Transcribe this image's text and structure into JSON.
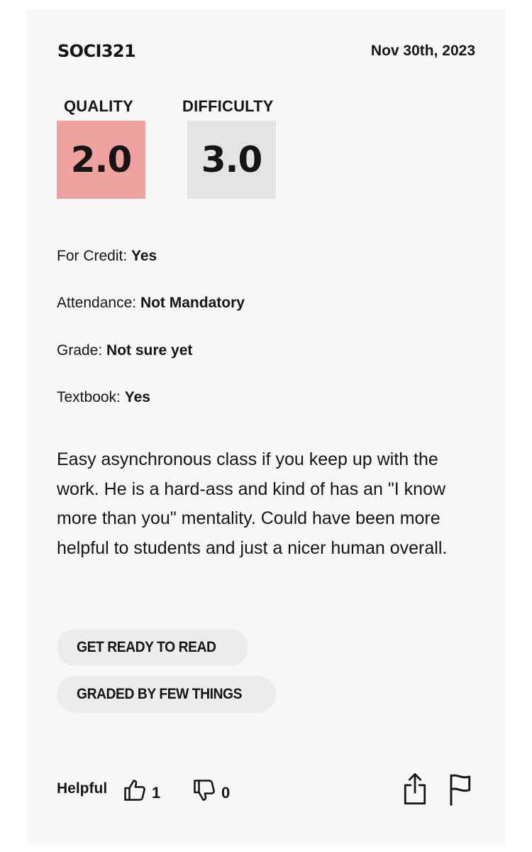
{
  "rating": {
    "course": "SOCI321",
    "date": "Nov 30th, 2023",
    "quality": {
      "label": "QUALITY",
      "value": "2.0",
      "color": "#f0a29f"
    },
    "difficulty": {
      "label": "DIFFICULTY",
      "value": "3.0",
      "color": "#e4e4e4"
    },
    "meta": [
      {
        "label": "For Credit:",
        "value": "Yes"
      },
      {
        "label": "Attendance:",
        "value": "Not Mandatory"
      },
      {
        "label": "Grade:",
        "value": "Not sure yet"
      },
      {
        "label": "Textbook:",
        "value": "Yes"
      }
    ],
    "comment": "Easy asynchronous class if you keep up with the work. He is a hard-ass and kind of has an \"I know more than you\" mentality. Could have been more helpful to students and just a nicer human overall.",
    "tags": [
      "GET READY TO READ",
      "GRADED BY FEW THINGS"
    ],
    "footer": {
      "helpful_label": "Helpful",
      "thumbs_up_count": "1",
      "thumbs_down_count": "0",
      "icons": [
        "thumbs-up-icon",
        "thumbs-down-icon",
        "share-icon",
        "flag-icon"
      ]
    }
  }
}
